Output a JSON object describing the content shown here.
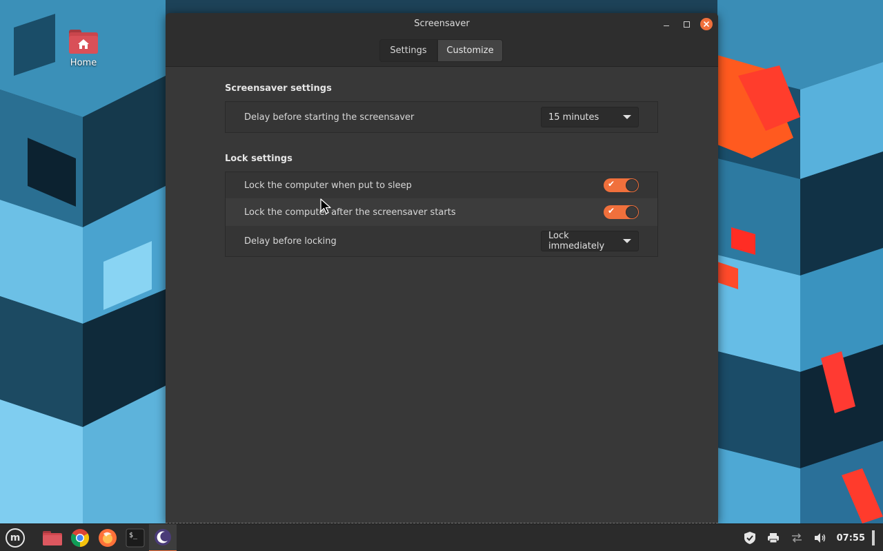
{
  "desktop": {
    "home_label": "Home"
  },
  "window": {
    "title": "Screensaver",
    "tabs": [
      {
        "label": "Settings",
        "active": false
      },
      {
        "label": "Customize",
        "active": true
      }
    ],
    "screensaver_section": {
      "title": "Screensaver settings",
      "delay_label": "Delay before starting the screensaver",
      "delay_value": "15 minutes"
    },
    "lock_section": {
      "title": "Lock settings",
      "lock_on_sleep_label": "Lock the computer when put to sleep",
      "lock_on_sleep_on": true,
      "lock_after_saver_label": "Lock the computer after the screensaver starts",
      "lock_after_saver_on": true,
      "lock_delay_label": "Delay before locking",
      "lock_delay_value": "Lock immediately"
    }
  },
  "taskbar": {
    "launchers": [
      "files-icon",
      "chrome-icon",
      "firefox-icon",
      "terminal-icon",
      "screensaver-icon"
    ],
    "clock": "07:55"
  },
  "colors": {
    "accent": "#f0703c",
    "window_bg": "#383838",
    "titlebar_bg": "#2e2e2e",
    "taskbar_bg": "#2b2b2b"
  }
}
